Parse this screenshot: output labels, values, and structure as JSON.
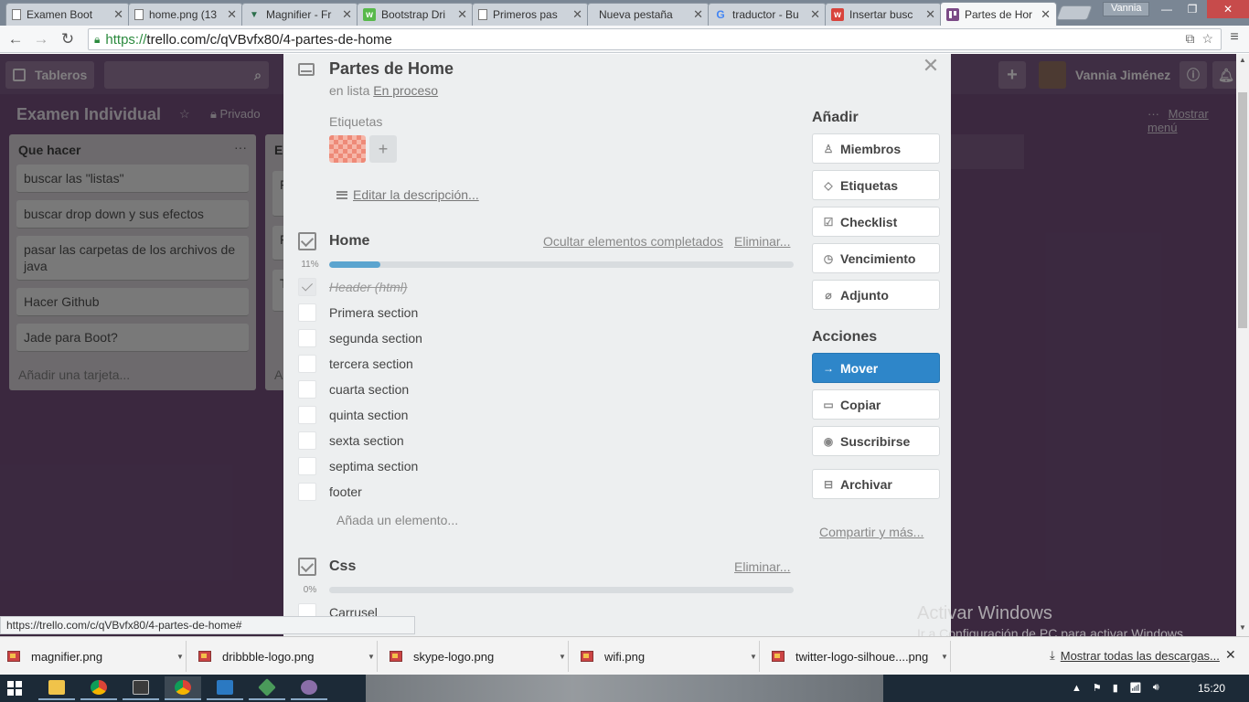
{
  "browser": {
    "tabs": [
      {
        "title": "Examen Boot",
        "favicon": "document-icon"
      },
      {
        "title": "home.png (13",
        "favicon": "document-icon"
      },
      {
        "title": "Magnifier - Fr",
        "favicon": "freepik-icon"
      },
      {
        "title": "Bootstrap Dri",
        "favicon": "webflow-icon"
      },
      {
        "title": "Primeros pas",
        "favicon": "document-icon"
      },
      {
        "title": "Nueva pestaña",
        "favicon": "none"
      },
      {
        "title": "traductor - Bu",
        "favicon": "google-icon"
      },
      {
        "title": "Insertar busc",
        "favicon": "wix-icon"
      },
      {
        "title": "Partes de Hor",
        "favicon": "trello-icon"
      }
    ],
    "active_tab": 8,
    "user_name": "Vannia",
    "url_scheme": "https://",
    "url_rest": "trello.com/c/qVBvfx80/4-partes-de-home",
    "status_url": "https://trello.com/c/qVBvfx80/4-partes-de-home#"
  },
  "trello": {
    "boards_label": "Tableros",
    "user": "Vannia Jiménez",
    "board_title": "Examen Individual",
    "visibility": "Privado",
    "show_menu": "Mostrar menú",
    "lists": [
      {
        "title": "Que hacer",
        "cards": [
          "buscar las \"listas\"",
          "buscar drop down y sus efectos",
          "pasar las carpetas de los archivos de java",
          "Hacer Github",
          "Jade para Boot?"
        ],
        "add_label": "Añadir una tarjeta..."
      },
      {
        "title": "E",
        "cards": [
          "F",
          "F",
          "T"
        ],
        "add_label": "A"
      }
    ]
  },
  "card": {
    "title": "Partes de Home",
    "in_list_prefix": "en lista",
    "list_name": "En proceso",
    "labels_heading": "Etiquetas",
    "edit_description": "Editar la descripción...",
    "checklists": [
      {
        "title": "Home",
        "hide_completed": "Ocultar elementos completados",
        "delete": "Eliminar...",
        "percent_label": "11%",
        "progress": 0.11,
        "items": [
          {
            "text": "Header (html)",
            "done": true
          },
          {
            "text": "Primera section",
            "done": false
          },
          {
            "text": "segunda section",
            "done": false
          },
          {
            "text": "tercera section",
            "done": false
          },
          {
            "text": "cuarta section",
            "done": false
          },
          {
            "text": "quinta section",
            "done": false
          },
          {
            "text": "sexta section",
            "done": false
          },
          {
            "text": "septima section",
            "done": false
          },
          {
            "text": "footer",
            "done": false
          }
        ],
        "add_item": "Añada un elemento..."
      },
      {
        "title": "Css",
        "delete": "Eliminar...",
        "percent_label": "0%",
        "progress": 0,
        "items": [
          {
            "text": "Carrusel",
            "done": false
          }
        ]
      }
    ],
    "sidebar": {
      "add_heading": "Añadir",
      "add_buttons": [
        {
          "label": "Miembros",
          "icon": "person-icon"
        },
        {
          "label": "Etiquetas",
          "icon": "tag-icon"
        },
        {
          "label": "Checklist",
          "icon": "checklist-icon"
        },
        {
          "label": "Vencimiento",
          "icon": "clock-icon"
        },
        {
          "label": "Adjunto",
          "icon": "paperclip-icon"
        }
      ],
      "actions_heading": "Acciones",
      "action_buttons": [
        {
          "label": "Mover",
          "icon": "arrow-right-icon"
        },
        {
          "label": "Copiar",
          "icon": "card-icon"
        },
        {
          "label": "Suscribirse",
          "icon": "eye-icon"
        },
        {
          "label": "Archivar",
          "icon": "archive-icon"
        }
      ],
      "share": "Compartir y más..."
    }
  },
  "watermark": {
    "line1": "Activar Windows",
    "line2": "Ir a Configuración de PC para activar Windows."
  },
  "downloads": {
    "items": [
      "magnifier.png",
      "dribbble-logo.png",
      "skype-logo.png",
      "wifi.png",
      "twitter-logo-silhoue....png"
    ],
    "show_all": "Mostrar todas las descargas..."
  },
  "taskbar": {
    "time": "15:20"
  }
}
